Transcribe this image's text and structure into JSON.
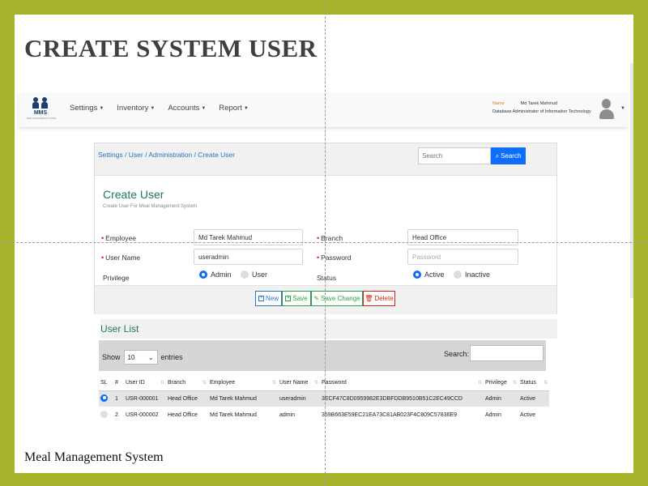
{
  "slide": {
    "title": "CREATE SYSTEM USER",
    "footer": "Meal Management System"
  },
  "navbar": {
    "logo_text": "MMS",
    "logo_subtext": "MEAL MANAGEMENT SYSTEM",
    "menu": [
      "Settings",
      "Inventory",
      "Accounts",
      "Report"
    ],
    "user": {
      "name_label": "Name",
      "name": "Md Tarek Mahmud",
      "role": "Database Administrator of Information Technology"
    }
  },
  "panel": {
    "breadcrumb": "Settings / User / Administration / Create User",
    "search_placeholder": "Search",
    "search_button": "Search",
    "form_title": "Create User",
    "form_subtitle": "Create User For Meal Management System",
    "fields": {
      "employee_label": "Employee",
      "employee_value": "Md Tarek Mahmud",
      "branch_label": "Branch",
      "branch_value": "Head Office",
      "username_label": "User Name",
      "username_value": "useradmin",
      "password_label": "Password",
      "password_placeholder": "Password",
      "privilege_label": "Privilege",
      "privilege_options": [
        "Admin",
        "User"
      ],
      "privilege_selected": "Admin",
      "status_label": "Status",
      "status_options": [
        "Active",
        "Inactive"
      ],
      "status_selected": "Active"
    },
    "buttons": {
      "new": "New",
      "save": "Save",
      "save_change": "Save Change",
      "delete": "Delete"
    }
  },
  "user_list": {
    "title": "User List",
    "show_label": "Show",
    "entries_value": "10",
    "entries_label": "entries",
    "search_label": "Search:",
    "columns": [
      "SL",
      "#",
      "User ID",
      "Branch",
      "Employee",
      "User Name",
      "Password",
      "Privilege",
      "Status"
    ],
    "rows": [
      {
        "selected": true,
        "num": "1",
        "user_id": "USR-000001",
        "branch": "Head Office",
        "employee": "Md Tarek Mahmud",
        "username": "useradmin",
        "password": "3ECF47C8D0959982E3DBFDDB9510B51C2EC49CCD",
        "privilege": "Admin",
        "status": "Active"
      },
      {
        "selected": false,
        "num": "2",
        "user_id": "USR-000002",
        "branch": "Head Office",
        "employee": "Md Tarek Mahmud",
        "username": "admin",
        "password": "359B663E59EC21EA73C81AB023F4C809C57836E9",
        "privilege": "Admin",
        "status": "Active"
      }
    ]
  },
  "colors": {
    "frame": "#a5b42b",
    "primary": "#0d6efd",
    "title_green": "#1f7a5a",
    "danger": "#d9230f"
  }
}
